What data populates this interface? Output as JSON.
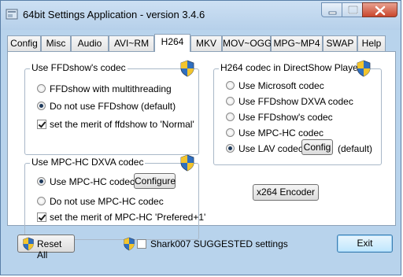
{
  "window": {
    "title": "64bit Settings Application - version 3.4.6"
  },
  "tabs": [
    {
      "label": "Config"
    },
    {
      "label": "Misc"
    },
    {
      "label": "Audio"
    },
    {
      "label": "AVI~RM"
    },
    {
      "label": "H264"
    },
    {
      "label": "MKV"
    },
    {
      "label": "MOV~OGG"
    },
    {
      "label": "MPG~MP4"
    },
    {
      "label": "SWAP"
    },
    {
      "label": "Help"
    }
  ],
  "active_tab": "H264",
  "ffdshow_group": {
    "title": "Use FFDshow's codec",
    "options": [
      {
        "label": "FFDshow with multithreading",
        "selected": false
      },
      {
        "label": "Do not use FFDshow (default)",
        "selected": true
      }
    ],
    "merit_checkbox": {
      "label": "set the merit of ffdshow to 'Normal'",
      "checked": true
    }
  },
  "mpchc_group": {
    "title": "Use MPC-HC DXVA codec",
    "options": [
      {
        "label": "Use MPC-HC codec",
        "selected": true
      },
      {
        "label": "Do not use MPC-HC codec",
        "selected": false
      }
    ],
    "configure_label": "Configure",
    "merit_checkbox": {
      "label": "set the merit of MPC-HC 'Prefered+1'",
      "checked": true
    }
  },
  "directshow_group": {
    "title": "H264 codec in DirectShow Players",
    "options": [
      {
        "label": "Use Microsoft codec",
        "selected": false
      },
      {
        "label": "Use FFDshow DXVA codec",
        "selected": false
      },
      {
        "label": "Use FFDshow's codec",
        "selected": false
      },
      {
        "label": "Use MPC-HC codec",
        "selected": false
      },
      {
        "label": "Use LAV codec",
        "selected": true
      }
    ],
    "config_label": "Config",
    "default_note": "(default)"
  },
  "x264_button": "x264 Encoder",
  "bottom": {
    "reset_label": "Reset All",
    "suggested_label": "Shark007 SUGGESTED settings",
    "suggested_checked": false,
    "exit_label": "Exit"
  },
  "colors": {
    "window_frame": "#b8d3ec",
    "close_button": "#c9462c",
    "radio_dot": "#1e3a5c"
  }
}
